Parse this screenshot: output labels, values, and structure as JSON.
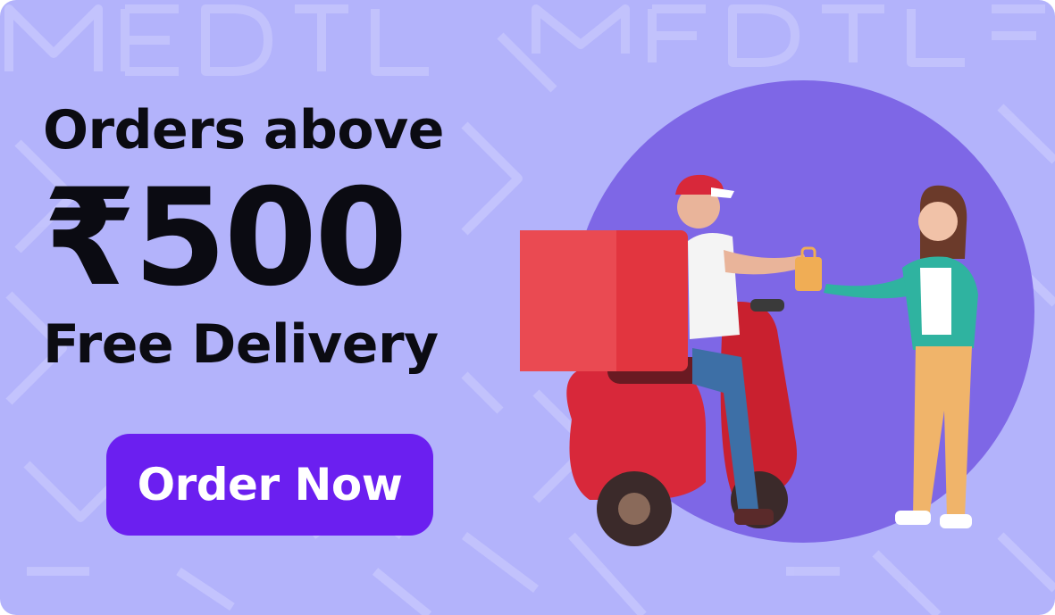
{
  "promo": {
    "line1": "Orders above",
    "line2": "₹500",
    "line3": "Free Delivery",
    "cta_label": "Order Now"
  },
  "colors": {
    "background": "#b3b3fb",
    "circle": "#7e67e6",
    "button": "#6b1ff0",
    "text": "#0b0b12"
  },
  "illustration": {
    "description_icon": "delivery-illustration"
  }
}
